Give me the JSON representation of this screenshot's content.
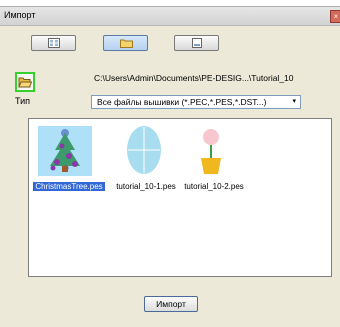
{
  "window": {
    "title": "Импорт",
    "close_glyph": "×"
  },
  "mode_buttons": [
    {
      "icon": "thumbnail-view-icon",
      "active": false
    },
    {
      "icon": "folder-icon",
      "active": true
    },
    {
      "icon": "card-icon",
      "active": false
    }
  ],
  "browse": {
    "icon": "open-folder-icon",
    "path": "C:\\Users\\Admin\\Documents\\PE-DESIG...\\Tutorial_10"
  },
  "filter": {
    "label": "Тип",
    "value": "Все файлы вышивки (*.PEC,*.PES,*.DST...)",
    "arrow": "▾"
  },
  "files": [
    {
      "name": "ChristmasTree.pes",
      "selected": true
    },
    {
      "name": "tutorial_10-1.pes",
      "selected": false
    },
    {
      "name": "tutorial_10-2.pes",
      "selected": false
    }
  ],
  "import_button": "Импорт",
  "colors": {
    "selection": "#3168d5",
    "highlight_border": "#35d22d",
    "accent": "#a8ddf0"
  }
}
